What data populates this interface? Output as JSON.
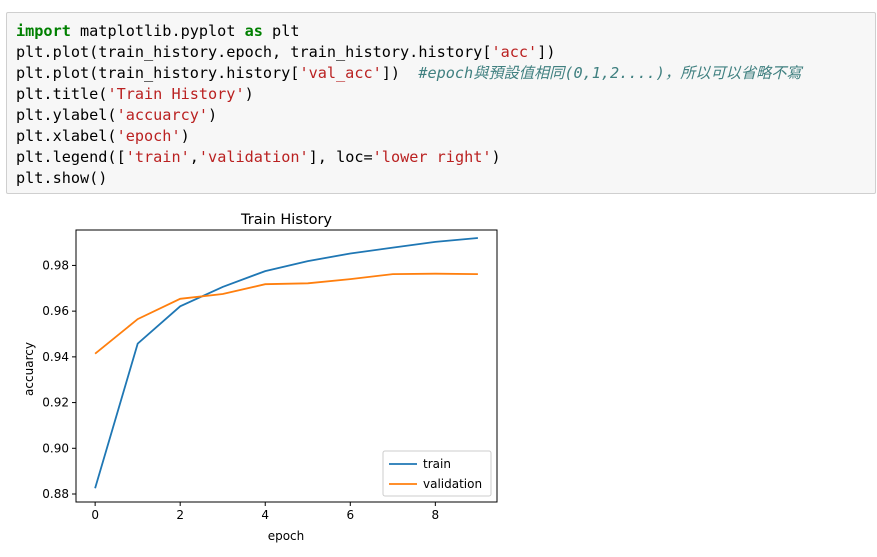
{
  "code_cell": {
    "lines": [
      [
        {
          "t": "import",
          "c": "kw"
        },
        {
          "t": " matplotlib.pyplot ",
          "c": ""
        },
        {
          "t": "as",
          "c": "kw"
        },
        {
          "t": " plt",
          "c": ""
        }
      ],
      [
        {
          "t": "plt.plot(train_history.epoch, train_history.history[",
          "c": ""
        },
        {
          "t": "'acc'",
          "c": "str"
        },
        {
          "t": "])",
          "c": ""
        }
      ],
      [
        {
          "t": "plt.plot(train_history.history[",
          "c": ""
        },
        {
          "t": "'val_acc'",
          "c": "str"
        },
        {
          "t": "])  ",
          "c": ""
        },
        {
          "t": "#epoch與預設值相同(0,1,2....)，所以可以省略不寫",
          "c": "cmt"
        }
      ],
      [
        {
          "t": "plt.title(",
          "c": ""
        },
        {
          "t": "'Train History'",
          "c": "str"
        },
        {
          "t": ")",
          "c": ""
        }
      ],
      [
        {
          "t": "plt.ylabel(",
          "c": ""
        },
        {
          "t": "'accuarcy'",
          "c": "str"
        },
        {
          "t": ")",
          "c": ""
        }
      ],
      [
        {
          "t": "plt.xlabel(",
          "c": ""
        },
        {
          "t": "'epoch'",
          "c": "str"
        },
        {
          "t": ")",
          "c": ""
        }
      ],
      [
        {
          "t": "plt.legend([",
          "c": ""
        },
        {
          "t": "'train'",
          "c": "str"
        },
        {
          "t": ",",
          "c": ""
        },
        {
          "t": "'validation'",
          "c": "str"
        },
        {
          "t": "], loc=",
          "c": ""
        },
        {
          "t": "'lower right'",
          "c": "str"
        },
        {
          "t": ")",
          "c": ""
        }
      ],
      [
        {
          "t": "plt.show()",
          "c": ""
        }
      ]
    ]
  },
  "chart_data": {
    "type": "line",
    "title": "Train History",
    "xlabel": "epoch",
    "ylabel": "accuarcy",
    "x": [
      0,
      1,
      2,
      3,
      4,
      5,
      6,
      7,
      8,
      9
    ],
    "xlim": [
      -0.45,
      9.45
    ],
    "ylim": [
      0.8765,
      0.9955
    ],
    "xticks": [
      0,
      2,
      4,
      6,
      8
    ],
    "yticks": [
      0.88,
      0.9,
      0.92,
      0.94,
      0.96,
      0.98
    ],
    "ytick_labels": [
      "0.88",
      "0.90",
      "0.92",
      "0.94",
      "0.96",
      "0.98"
    ],
    "grid": false,
    "legend_position": "lower right",
    "series": [
      {
        "name": "train",
        "color": "#1f77b4",
        "values": [
          0.8825,
          0.9458,
          0.9621,
          0.9706,
          0.9775,
          0.9819,
          0.9852,
          0.9878,
          0.9903,
          0.992
        ]
      },
      {
        "name": "validation",
        "color": "#ff7f0e",
        "values": [
          0.9414,
          0.9565,
          0.9654,
          0.9675,
          0.9718,
          0.9722,
          0.974,
          0.9762,
          0.9764,
          0.9762
        ]
      }
    ]
  }
}
